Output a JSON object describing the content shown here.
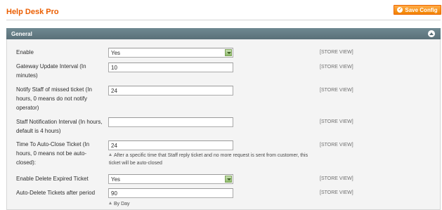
{
  "header": {
    "title": "Help Desk Pro",
    "save_label": "Save Config"
  },
  "fieldset": {
    "title": "General"
  },
  "fields": [
    {
      "label": "Enable",
      "type": "select",
      "value": "Yes",
      "scope": "[STORE VIEW]"
    },
    {
      "label": "Gateway Update Interval (In minutes)",
      "type": "text",
      "value": "10",
      "scope": "[STORE VIEW]"
    },
    {
      "label": "Notify Staff of missed ticket (In hours, 0 means do not notify operator)",
      "type": "text",
      "value": "24",
      "scope": "[STORE VIEW]"
    },
    {
      "label": "Staff Notification Interval (In hours, default is 4 hours)",
      "type": "text",
      "value": "",
      "scope": "[STORE VIEW]"
    },
    {
      "label": "Time To Auto-Close Ticket (In hours, 0 means not be auto-closed):",
      "type": "text",
      "value": "24",
      "scope": "[STORE VIEW]",
      "note": "After a specific time that Staff reply ticket and no more request is sent from customer, this ticket will be auto-closed"
    },
    {
      "label": "Enable Delete Expired Ticket",
      "type": "select",
      "value": "Yes",
      "scope": "[STORE VIEW]"
    },
    {
      "label": "Auto-Delete Tickets after period",
      "type": "text",
      "value": "90",
      "scope": "[STORE VIEW]",
      "note": "By Day"
    }
  ]
}
